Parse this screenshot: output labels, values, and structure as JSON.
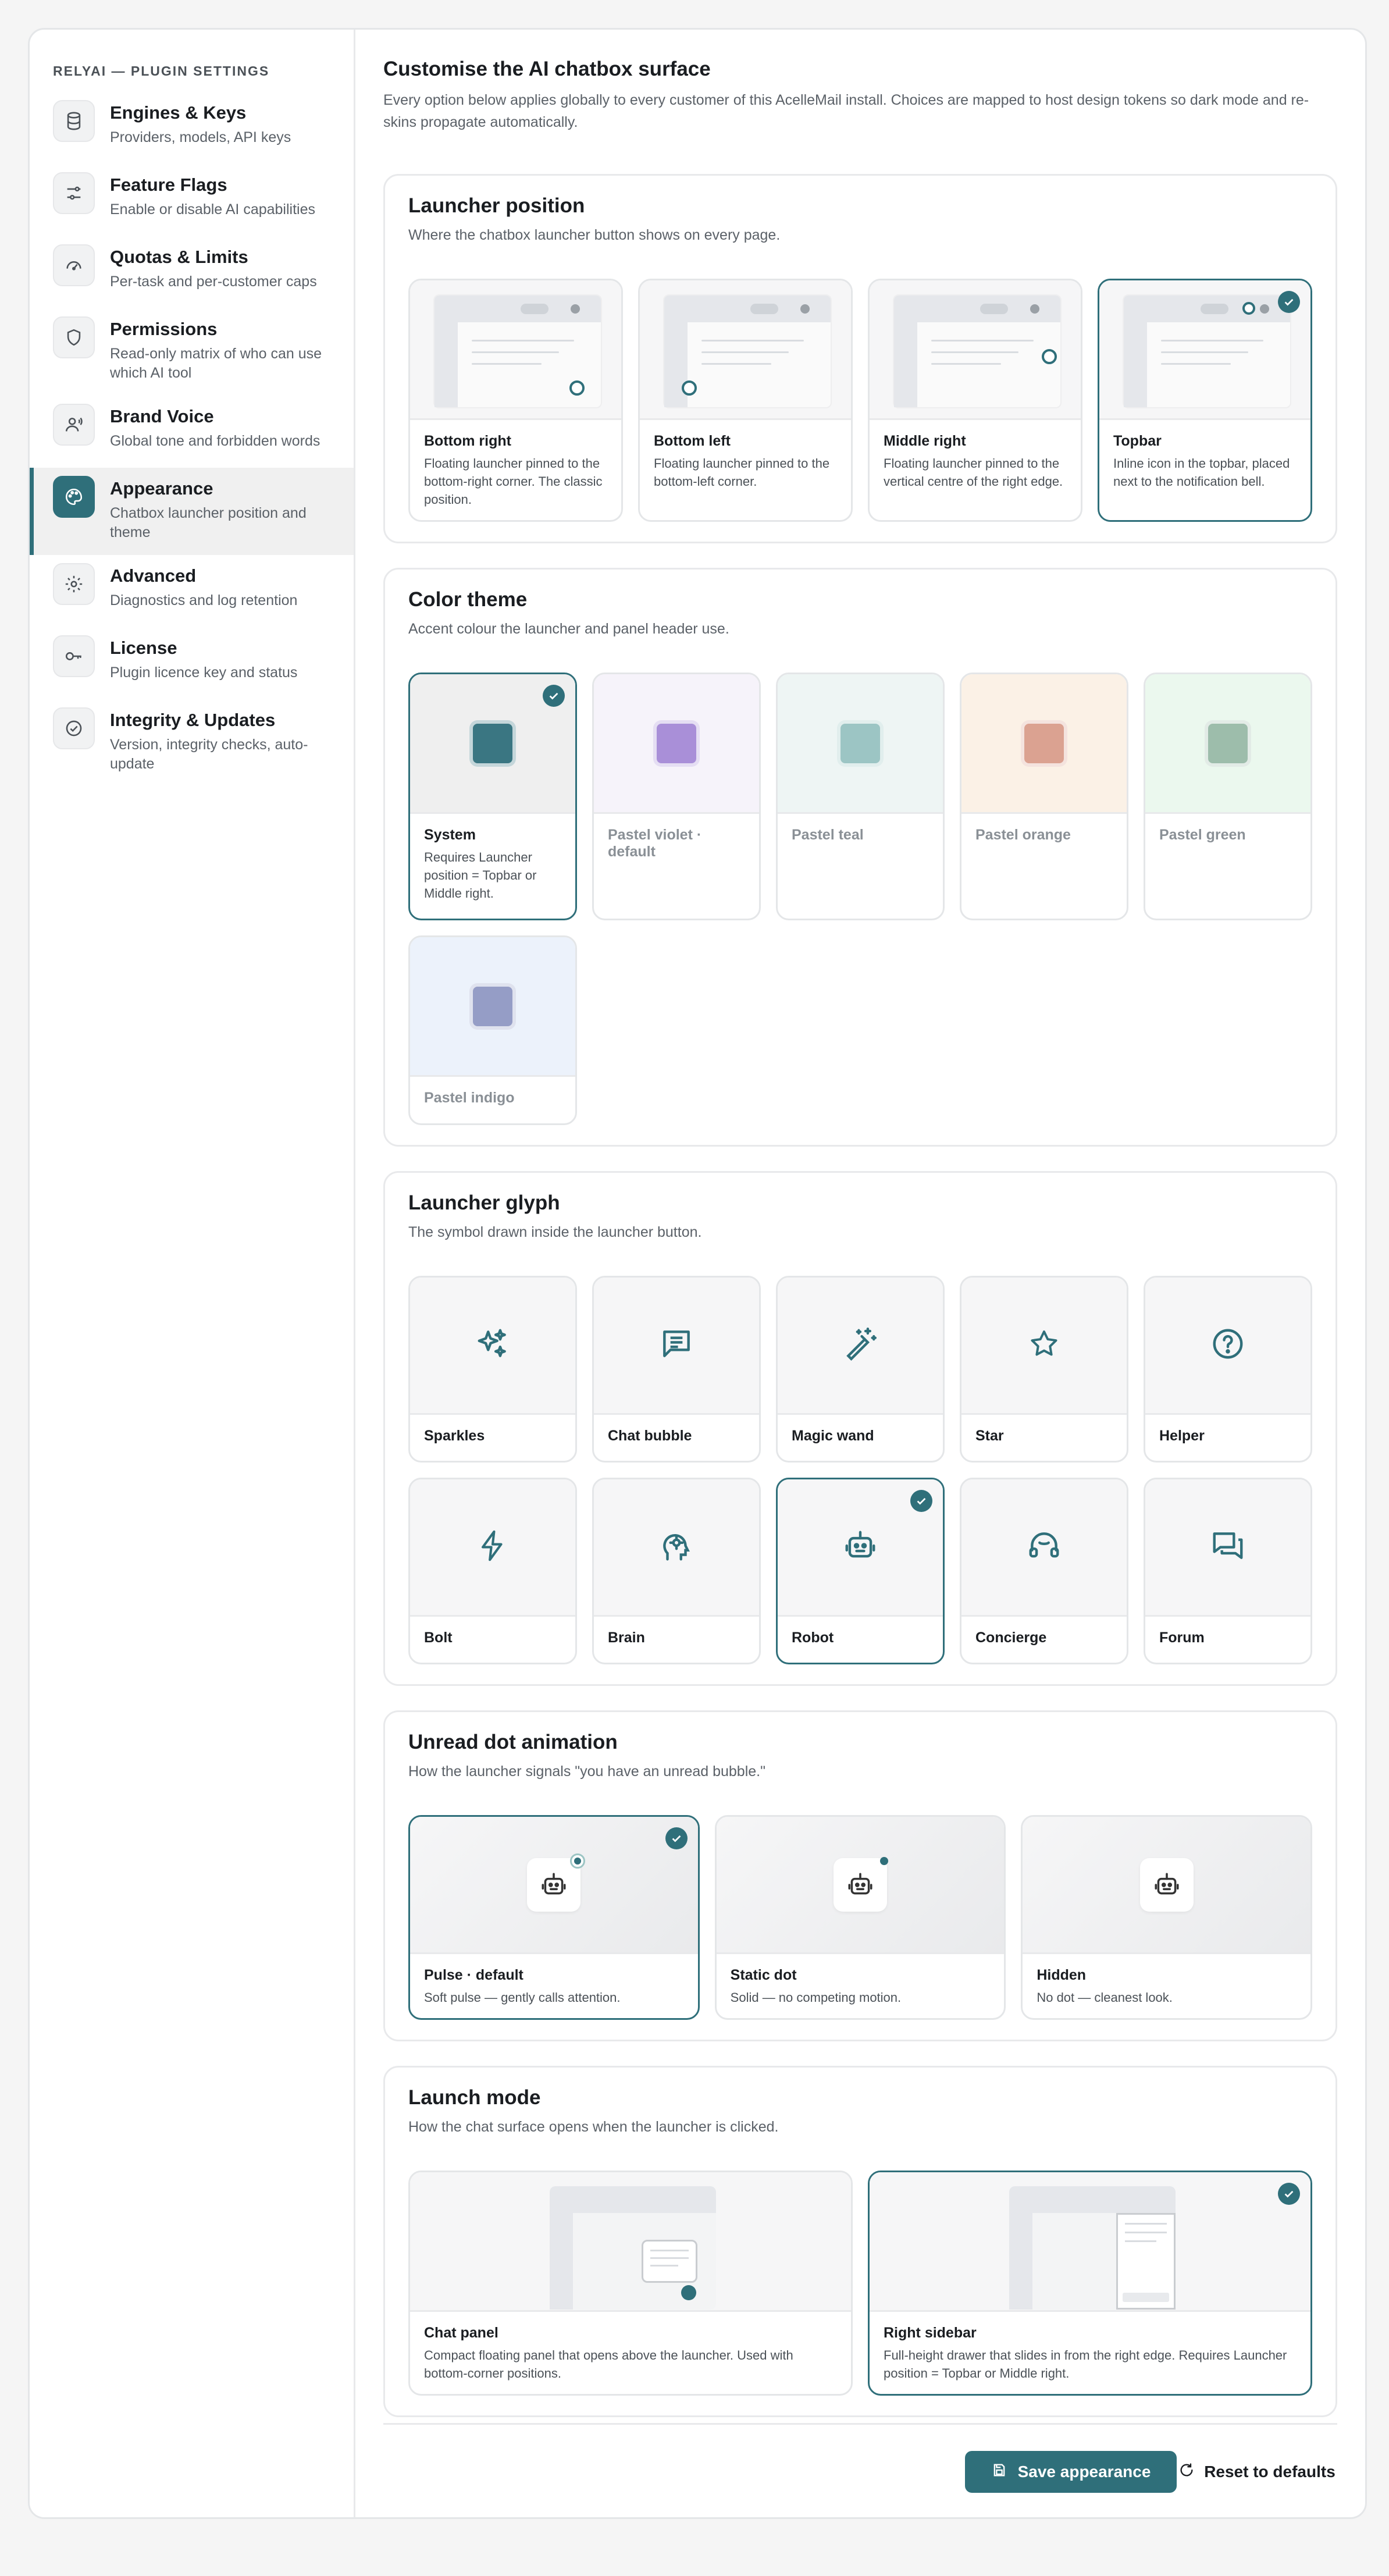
{
  "sidebar": {
    "heading": "RELYAI — PLUGIN SETTINGS",
    "items": [
      {
        "title": "Engines & Keys",
        "sub": "Providers, models, API keys",
        "icon": "database-icon"
      },
      {
        "title": "Feature Flags",
        "sub": "Enable or disable AI capabilities",
        "icon": "sliders-icon"
      },
      {
        "title": "Quotas & Limits",
        "sub": "Per-task and per-customer caps",
        "icon": "gauge-icon"
      },
      {
        "title": "Permissions",
        "sub": "Read-only matrix of who can use which AI tool",
        "icon": "shield-icon"
      },
      {
        "title": "Brand Voice",
        "sub": "Global tone and forbidden words",
        "icon": "voice-icon"
      },
      {
        "title": "Appearance",
        "sub": "Chatbox launcher position and theme",
        "icon": "palette-icon",
        "active": true
      },
      {
        "title": "Advanced",
        "sub": "Diagnostics and log retention",
        "icon": "gear-icon"
      },
      {
        "title": "License",
        "sub": "Plugin licence key and status",
        "icon": "key-icon"
      },
      {
        "title": "Integrity & Updates",
        "sub": "Version, integrity checks, auto-update",
        "icon": "check-badge-icon"
      }
    ]
  },
  "main": {
    "title": "Customise the AI chatbox surface",
    "desc": "Every option below applies globally to every customer of this AcelleMail install. Choices are mapped to host design tokens so dark mode and re-skins propagate automatically."
  },
  "launcher_position": {
    "title": "Launcher position",
    "sub": "Where the chatbox launcher button shows on every page.",
    "options": [
      {
        "title": "Bottom right",
        "desc": "Floating launcher pinned to the bottom-right corner. The classic position."
      },
      {
        "title": "Bottom left",
        "desc": "Floating launcher pinned to the bottom-left corner."
      },
      {
        "title": "Middle right",
        "desc": "Floating launcher pinned to the vertical centre of the right edge."
      },
      {
        "title": "Topbar",
        "desc": "Inline icon in the topbar, placed next to the notification bell.",
        "selected": true
      }
    ]
  },
  "color_theme": {
    "title": "Color theme",
    "sub": "Accent colour the launcher and panel header use.",
    "options": [
      {
        "title": "System",
        "desc": "Requires Launcher position = Topbar or Middle right.",
        "bg": "#efefef",
        "swatch": "#3a7682",
        "selected": true
      },
      {
        "title": "Pastel violet · default",
        "desc": "",
        "bg": "#f6f3fa",
        "swatch": "#a98fd8"
      },
      {
        "title": "Pastel teal",
        "desc": "",
        "bg": "#eef5f4",
        "swatch": "#9cc5c4"
      },
      {
        "title": "Pastel orange",
        "desc": "",
        "bg": "#fbf1e6",
        "swatch": "#dba291"
      },
      {
        "title": "Pastel green",
        "desc": "",
        "bg": "#ebf8ee",
        "swatch": "#9dbdab"
      },
      {
        "title": "Pastel indigo",
        "desc": "",
        "bg": "#ecf2fb",
        "swatch": "#959dc6"
      }
    ]
  },
  "glyph": {
    "title": "Launcher glyph",
    "sub": "The symbol drawn inside the launcher button.",
    "options": [
      {
        "title": "Sparkles",
        "icon": "sparkles-icon"
      },
      {
        "title": "Chat bubble",
        "icon": "chat-bubble-icon"
      },
      {
        "title": "Magic wand",
        "icon": "magic-wand-icon"
      },
      {
        "title": "Star",
        "icon": "star-icon"
      },
      {
        "title": "Helper",
        "icon": "help-circle-icon"
      },
      {
        "title": "Bolt",
        "icon": "bolt-icon"
      },
      {
        "title": "Brain",
        "icon": "brain-icon"
      },
      {
        "title": "Robot",
        "icon": "robot-icon",
        "selected": true
      },
      {
        "title": "Concierge",
        "icon": "headset-icon"
      },
      {
        "title": "Forum",
        "icon": "forum-icon"
      }
    ]
  },
  "unread": {
    "title": "Unread dot animation",
    "sub": "How the launcher signals \"you have an unread bubble.\"",
    "options": [
      {
        "title": "Pulse · default",
        "desc": "Soft pulse — gently calls attention.",
        "selected": true
      },
      {
        "title": "Static dot",
        "desc": "Solid — no competing motion."
      },
      {
        "title": "Hidden",
        "desc": "No dot — cleanest look."
      }
    ]
  },
  "launch_mode": {
    "title": "Launch mode",
    "sub": "How the chat surface opens when the launcher is clicked.",
    "options": [
      {
        "title": "Chat panel",
        "desc": "Compact floating panel that opens above the launcher. Used with bottom-corner positions."
      },
      {
        "title": "Right sidebar",
        "desc": "Full-height drawer that slides in from the right edge. Requires Launcher position = Topbar or Middle right.",
        "selected": true
      }
    ]
  },
  "actions": {
    "save": "Save appearance",
    "reset": "Reset to defaults"
  },
  "colors": {
    "accent": "#2f6f7a"
  }
}
